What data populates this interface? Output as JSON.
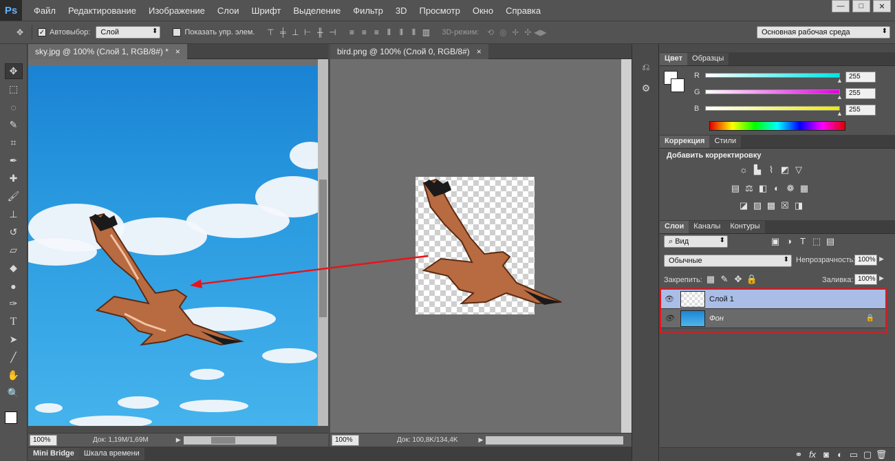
{
  "app": {
    "logo": "Ps"
  },
  "menu": [
    "Файл",
    "Редактирование",
    "Изображение",
    "Слои",
    "Шрифт",
    "Выделение",
    "Фильтр",
    "3D",
    "Просмотр",
    "Окно",
    "Справка"
  ],
  "window_buttons": {
    "minimize": "—",
    "restore": "□",
    "close": "✕"
  },
  "options": {
    "autoselect_label": "Автовыбор:",
    "autoselect_value": "Слой",
    "show_controls_label": "Показать упр. элем.",
    "mode3d_label": "3D-режим:",
    "workspace": "Основная рабочая среда"
  },
  "docs": {
    "sky": {
      "tab": "sky.jpg @ 100% (Слой 1, RGB/8#) *",
      "close": "×",
      "zoom": "100%",
      "status": "Док: 1,19M/1,69M"
    },
    "bird": {
      "tab": "bird.png @ 100% (Слой 0, RGB/8#)",
      "close": "×",
      "zoom": "100%",
      "status": "Док: 100,8K/134,4K"
    }
  },
  "bottom_tabs": [
    "Mini Bridge",
    "Шкала времени"
  ],
  "color_panel": {
    "tabs": [
      "Цвет",
      "Образцы"
    ],
    "channels": [
      {
        "label": "R",
        "value": "255",
        "color": "#00e5e5"
      },
      {
        "label": "G",
        "value": "255",
        "color": "#e000e0"
      },
      {
        "label": "B",
        "value": "255",
        "color": "#ecec00"
      }
    ]
  },
  "adjust_panel": {
    "tabs": [
      "Коррекция",
      "Стили"
    ],
    "title": "Добавить корректировку"
  },
  "layers_panel": {
    "tabs": [
      "Слои",
      "Каналы",
      "Контуры"
    ],
    "filter": "Вид",
    "blend": "Обычные",
    "opacity_label": "Непрозрачность:",
    "opacity": "100%",
    "lock_label": "Закрепить:",
    "fill_label": "Заливка:",
    "fill": "100%",
    "layers": [
      {
        "name": "Слой 1",
        "selected": true
      },
      {
        "name": "Фон",
        "selected": false
      }
    ]
  },
  "colors": {
    "accent_red": "#e8141b",
    "selection": "#a9bde6",
    "arrow": "#e8141b"
  }
}
